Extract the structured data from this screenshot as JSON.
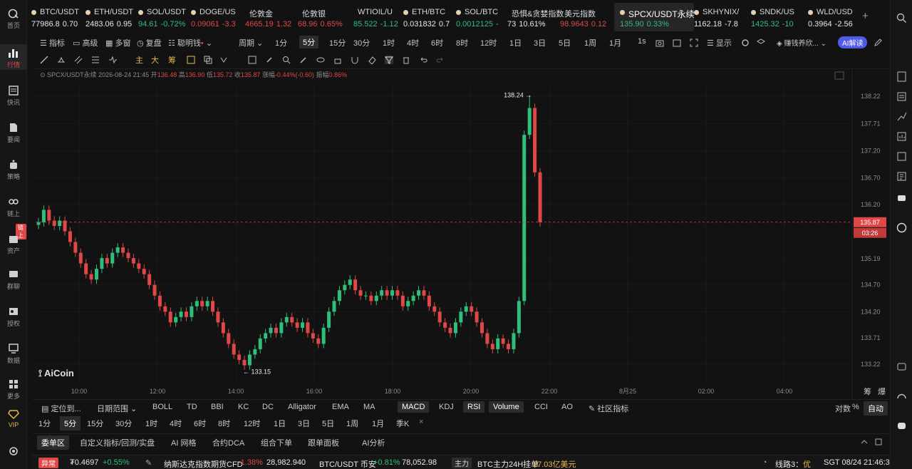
{
  "sidebar": {
    "items": [
      {
        "label": "首页",
        "icon": "logo-icon"
      },
      {
        "label": "行情",
        "icon": "bar-chart-icon",
        "active": true
      },
      {
        "label": "快讯",
        "icon": "news-icon"
      },
      {
        "label": "要闻",
        "icon": "document-icon"
      },
      {
        "label": "策略",
        "icon": "robot-icon"
      },
      {
        "label": "链上",
        "icon": "chain-icon"
      },
      {
        "label": "资产",
        "icon": "wallet-icon"
      },
      {
        "label": "群聊",
        "icon": "chat-icon"
      },
      {
        "label": "授权",
        "icon": "key-icon"
      },
      {
        "label": "数据",
        "icon": "monitor-icon"
      },
      {
        "label": "更多",
        "icon": "grid-icon"
      },
      {
        "label": "VIP",
        "icon": "diamond-icon"
      },
      {
        "label": "",
        "icon": "settings-icon"
      }
    ],
    "badge": "链上"
  },
  "tickers": [
    {
      "name": "BTC/USDT",
      "price": "77986.8",
      "change": "0.70",
      "dir": "wh"
    },
    {
      "name": "ETH/USDT",
      "price": "2483.06",
      "change": "0.95",
      "dir": "wh"
    },
    {
      "name": "SOL/USDT",
      "price": "94.61",
      "change": "-0.72%",
      "dir": "up"
    },
    {
      "name": "DOGE/US",
      "price": "0.09061",
      "change": "-3.3",
      "dir": "dn"
    },
    {
      "name": "伦敦金",
      "price": "4665.19",
      "change": "1.32",
      "dir": "dn"
    },
    {
      "name": "伦敦银",
      "price": "68.96",
      "change": "0.65%",
      "dir": "dn"
    },
    {
      "name": "WTIOIL/U",
      "price": "85.522",
      "change": "-1.12",
      "dir": "up"
    },
    {
      "name": "ETH/BTC",
      "price": "0.031832",
      "change": "0.7",
      "dir": "wh"
    },
    {
      "name": "SOL/BTC",
      "price": "0.0012125",
      "change": "-",
      "dir": "up"
    },
    {
      "name": "恐惧&贪婪指数",
      "price": "73",
      "change": "10.61%",
      "dir": "wh"
    },
    {
      "name": "美元指数",
      "price": "98.9643",
      "change": "0.12",
      "dir": "dn"
    },
    {
      "name": "SPCX/USDT永续",
      "price": "135.90",
      "change": "0.33%",
      "dir": "up"
    },
    {
      "name": "SKHYNIX/",
      "price": "1162.18",
      "change": "-7.8",
      "dir": "wh"
    },
    {
      "name": "SNDK/US",
      "price": "1425.32",
      "change": "-10",
      "dir": "up"
    },
    {
      "name": "WLD/USD",
      "price": "0.3964",
      "change": "-2.56",
      "dir": "wh"
    }
  ],
  "toolbar1": {
    "indicator": "指标",
    "advanced": "高级",
    "multi": "多窗",
    "replay": "复盘",
    "smart_money": "聪明钱",
    "period": "周期",
    "intervals": [
      "1分",
      "5分",
      "15分",
      "30分",
      "1时",
      "4时",
      "6时",
      "8时",
      "12时",
      "1日",
      "3日",
      "5日",
      "1周",
      "1月"
    ],
    "selected_interval": "5分",
    "second": "1s",
    "display": "显示",
    "strategy": "赚钱养欣...",
    "ai_button": "AI解读"
  },
  "toolbar2": {
    "tags": [
      "主",
      "大",
      "筹"
    ]
  },
  "chart_header": {
    "symbol": "SPCX/USDT永续",
    "datetime": "2026-08-24 21:45",
    "open_label": "开",
    "open": "136.48",
    "high_label": "高",
    "high": "136.90",
    "low_label": "低",
    "low": "135.72",
    "close_label": "收",
    "close": "135.87",
    "change_label": "涨幅",
    "change": "-0.44%(-0.60)",
    "amp_label": "振幅",
    "amp": "0.86%"
  },
  "chart_data": {
    "type": "candlestick",
    "y_ticks": [
      "138.22",
      "137.71",
      "137.20",
      "136.70",
      "136.20",
      "135.19",
      "134.70",
      "134.20",
      "133.71",
      "133.22"
    ],
    "x_ticks": [
      "10:00",
      "12:00",
      "14:00",
      "16:00",
      "18:00",
      "20:00",
      "22:00",
      "8月25",
      "02:00",
      "04:00"
    ],
    "high_marker": "138.24",
    "low_marker": "133.15",
    "last_price": "135.87",
    "countdown": "03:26",
    "ylim": [
      133.0,
      138.5
    ],
    "closes": [
      135.87,
      136.1,
      135.9,
      135.8,
      135.9,
      135.7,
      135.5,
      135.3,
      135.1,
      134.9,
      134.8,
      135.0,
      135.2,
      135.1,
      135.3,
      135.4,
      135.3,
      135.2,
      135.1,
      135.0,
      134.9,
      134.7,
      134.5,
      134.3,
      134.2,
      134.0,
      134.1,
      134.2,
      134.1,
      134.3,
      134.4,
      134.3,
      134.4,
      134.2,
      134.0,
      133.8,
      133.6,
      133.4,
      133.3,
      133.2,
      133.4,
      133.5,
      133.7,
      133.8,
      133.9,
      133.8,
      134.0,
      134.1,
      134.0,
      133.9,
      134.0,
      133.8,
      133.7,
      133.6,
      133.9,
      134.2,
      134.4,
      134.6,
      134.7,
      134.8,
      134.6,
      134.5,
      134.5,
      134.4,
      134.5,
      134.6,
      134.5,
      134.6,
      134.5,
      134.3,
      134.4,
      134.5,
      134.6,
      134.5,
      134.3,
      134.2,
      134.0,
      133.9,
      133.8,
      134.0,
      134.2,
      134.3,
      134.2,
      134.0,
      133.8,
      133.6,
      133.5,
      133.7,
      133.6,
      133.5,
      133.8,
      134.4,
      137.5,
      138.0,
      136.8,
      135.87
    ]
  },
  "indicators_row": {
    "locate": "定位到...",
    "date_range": "日期范围",
    "main_inds": [
      "BOLL",
      "TD",
      "BBI",
      "KC",
      "DC",
      "Alligator",
      "EMA",
      "MA"
    ],
    "sub_inds": [
      "MACD",
      "KDJ",
      "RSI",
      "Volume",
      "CCI",
      "AO"
    ],
    "community": "社区指标",
    "log": "对数",
    "pct": "%",
    "auto": "自动",
    "bottom_right": [
      "筹",
      "爆"
    ]
  },
  "interval_row": [
    "1分",
    "5分",
    "15分",
    "30分",
    "1时",
    "4时",
    "6时",
    "8时",
    "12时",
    "1日",
    "3日",
    "5日",
    "1周",
    "1月",
    "季K"
  ],
  "bottom_tabs": [
    "委单区",
    "自定义指标/回测/实盘",
    "AI 网格",
    "合约DCA",
    "组合下单",
    "跟单面板",
    "AI分析"
  ],
  "status": {
    "alert": "异常",
    "coin_price": "₮0.4697",
    "coin_change": "+0.55%",
    "cfd_name": "纳斯达克指数期货CFD",
    "cfd_change": "-1.38%",
    "cfd_price": "28,982.940",
    "btc_name": "BTC/USDT 币安",
    "btc_change": "+0.81%",
    "btc_price": "78,052.98",
    "main_force": "主力",
    "main_force_text": "BTC主力24H挂单",
    "main_force_value": "27.03亿美元",
    "line": "线路3：",
    "line_quality": "优",
    "clock": "SGT 08/24 21:46:33"
  },
  "logo": "AiCoin"
}
